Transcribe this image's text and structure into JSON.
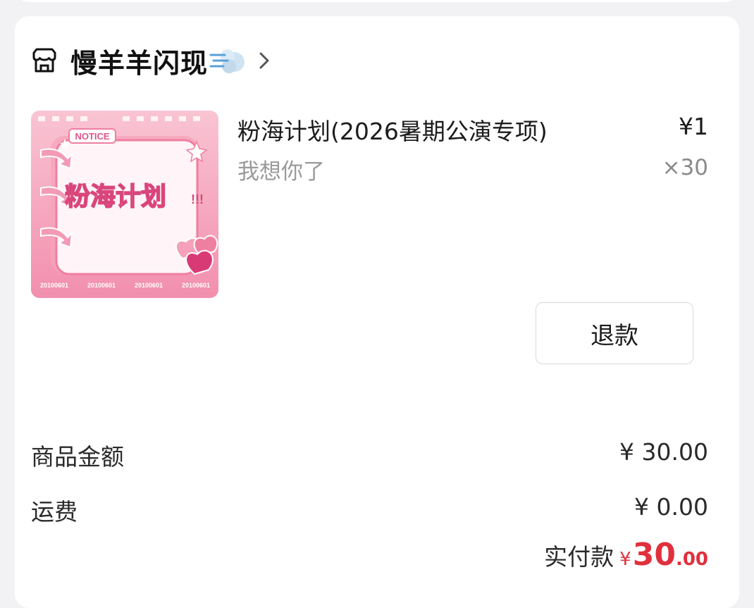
{
  "shop": {
    "name": "慢羊羊闪现",
    "icon": "store-icon",
    "emoji_icon": "dash-symbol-icon",
    "chevron": "chevron-right-icon"
  },
  "product": {
    "title": "粉海计划(2026暑期公演专项)",
    "variant": "我想你了",
    "price": "¥1",
    "quantity": "×30",
    "image": {
      "notice": "NOTICE",
      "headline": "粉海计划",
      "exclaim": "!!!",
      "codes": [
        "20100601",
        "20100601",
        "20100601",
        "20100601"
      ]
    }
  },
  "actions": {
    "refund_label": "退款"
  },
  "summary": {
    "goods_label": "商品金额",
    "goods_value": "¥ 30.00",
    "shipping_label": "运费",
    "shipping_value": "¥ 0.00",
    "paid_label": "实付款",
    "paid_symbol": "¥",
    "paid_integer": "30",
    "paid_decimal": ".00"
  },
  "colors": {
    "accent_red": "#e0303c",
    "card_bg": "#ffffff",
    "page_bg": "#f2f2f4",
    "thumb_pink": "#f7a8bf"
  }
}
